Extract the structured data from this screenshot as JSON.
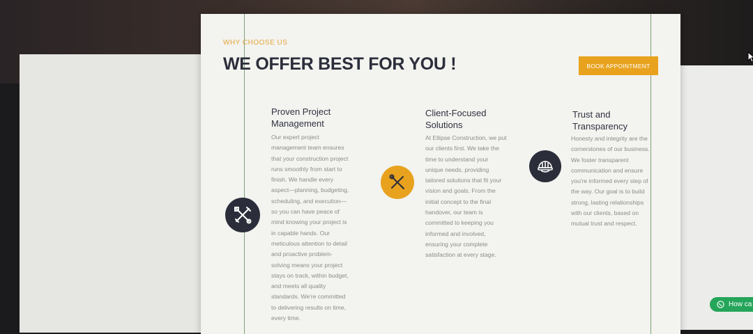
{
  "section": {
    "eyebrow": "WHY CHOOSE US",
    "heading": "WE OFFER BEST FOR YOU !",
    "cta_label": "BOOK APPOINTMENT"
  },
  "features": [
    {
      "title_line1": "Proven Project",
      "title_line2": "Management",
      "icon": "tools-icon",
      "text": [
        "Our expert project",
        "management team ensures",
        "that your construction project",
        "runs smoothly from start to",
        "finish. We handle every",
        "aspect—planning, budgeting,",
        "scheduling, and execution—",
        "so you can have peace of",
        "mind knowing your project is",
        "in capable hands. Our",
        "meticulous attention to detail",
        "and proactive problem-",
        "solving means your project",
        "stays on track, within budget,",
        "and meets all quality",
        "standards. We're committed",
        "to delivering results on time,",
        "every time."
      ]
    },
    {
      "title_line1": "Client-Focused",
      "title_line2": "Solutions",
      "icon": "wrench-screwdriver-icon",
      "text": [
        "At Ellipse Construction, we put",
        "our clients first. We take the",
        "time to understand your",
        "unique needs, providing",
        "tailored solutions that fit your",
        "vision and goals. From the",
        "initial concept to the final",
        "handover, our team is",
        "committed to keeping you",
        "informed and involved,",
        "ensuring your complete",
        "satisfaction at every stage."
      ]
    },
    {
      "title_line1": "Trust and",
      "title_line2": "Transparency",
      "icon": "hardhat-icon",
      "text": [
        "Honesty and integrity are the",
        "cornerstones of our business.",
        "We foster transparent",
        "communication and ensure",
        "you're informed every step of",
        "the way. Our goal is to build",
        "strong, lasting relationships",
        "with our clients, based on",
        "mutual trust and respect."
      ]
    }
  ],
  "whatsapp": {
    "label": "How ca"
  },
  "colors": {
    "accent": "#e8a21e",
    "dark": "#2b2e3a",
    "whatsapp": "#25a55a"
  }
}
